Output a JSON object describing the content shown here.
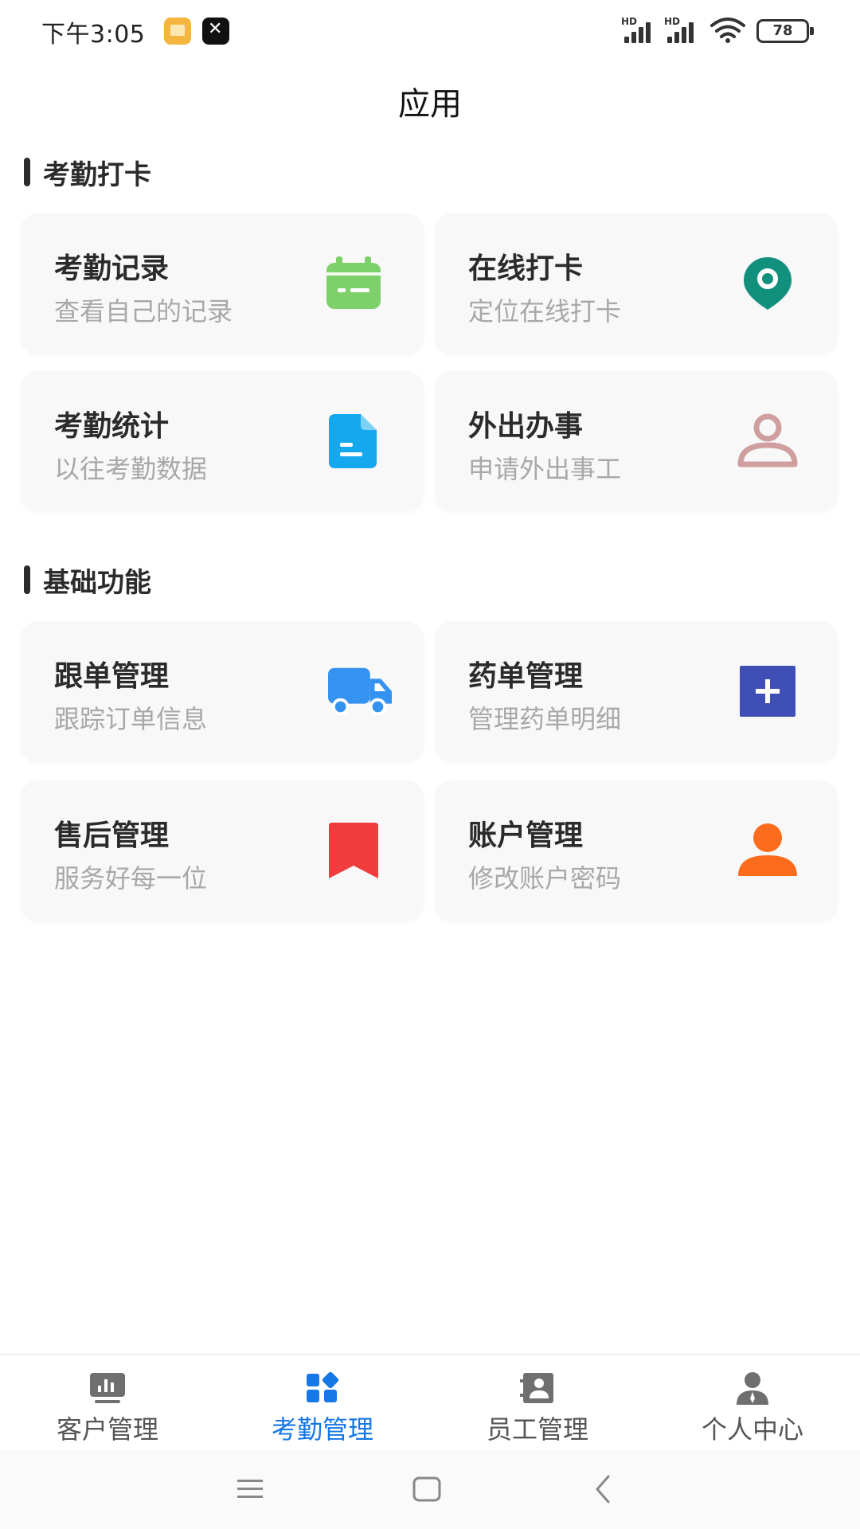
{
  "status_bar": {
    "time": "下午3:05",
    "battery": "78",
    "network_label": "HD"
  },
  "page": {
    "title": "应用"
  },
  "sections": [
    {
      "label": "考勤打卡",
      "cards": [
        {
          "title": "考勤记录",
          "subtitle": "查看自己的记录",
          "icon": "calendar-icon",
          "color": "#7ed06a"
        },
        {
          "title": "在线打卡",
          "subtitle": "定位在线打卡",
          "icon": "location-pin-icon",
          "color": "#12907e"
        },
        {
          "title": "考勤统计",
          "subtitle": "以往考勤数据",
          "icon": "document-icon",
          "color": "#15a8ef"
        },
        {
          "title": "外出办事",
          "subtitle": "申请外出事工",
          "icon": "person-outline-icon",
          "color": "#cf9e9e"
        }
      ]
    },
    {
      "label": "基础功能",
      "cards": [
        {
          "title": "跟单管理",
          "subtitle": "跟踪订单信息",
          "icon": "truck-icon",
          "color": "#3493f0"
        },
        {
          "title": "药单管理",
          "subtitle": "管理药单明细",
          "icon": "plus-box-icon",
          "color": "#3f4fb5"
        },
        {
          "title": "售后管理",
          "subtitle": "服务好每一位",
          "icon": "bookmark-icon",
          "color": "#f03c3c"
        },
        {
          "title": "账户管理",
          "subtitle": "修改账户密码",
          "icon": "person-solid-icon",
          "color": "#fb6c1c"
        }
      ]
    }
  ],
  "tab_bar": {
    "active_color": "#1677e6",
    "items": [
      {
        "label": "客户管理",
        "icon": "monitor-chart-icon",
        "active": false
      },
      {
        "label": "考勤管理",
        "icon": "apps-grid-icon",
        "active": true
      },
      {
        "label": "员工管理",
        "icon": "contact-card-icon",
        "active": false
      },
      {
        "label": "个人中心",
        "icon": "user-icon",
        "active": false
      }
    ]
  }
}
